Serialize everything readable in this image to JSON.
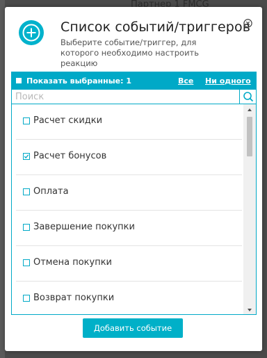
{
  "background": {
    "partial_text": "Партнер 1 FMCG"
  },
  "dialog": {
    "title": "Список событий/триггеров",
    "subtitle": "Выберите событие/триггер, для которого необходимо настроить реакцию",
    "add_icon": "plus-circle-icon",
    "close_icon": "close-circle-icon"
  },
  "toolbar": {
    "show_selected_label": "Показать выбранные: 1",
    "all_link": "Все",
    "none_link": "Ни одного"
  },
  "search": {
    "placeholder": "Поиск",
    "value": "",
    "icon": "search-icon"
  },
  "items": [
    {
      "label": "Расчет скидки",
      "checked": false
    },
    {
      "label": "Расчет бонусов",
      "checked": true
    },
    {
      "label": "Оплата",
      "checked": false
    },
    {
      "label": "Завершение покупки",
      "checked": false
    },
    {
      "label": "Отмена покупки",
      "checked": false
    },
    {
      "label": "Возврат покупки",
      "checked": false
    }
  ],
  "footer": {
    "add_button": "Добавить событие"
  },
  "colors": {
    "accent": "#00a9c7",
    "button": "#00b0c8",
    "overlay": "#4a4a4a"
  }
}
